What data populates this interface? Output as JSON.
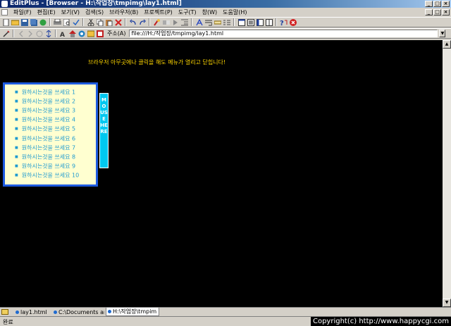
{
  "window": {
    "title": "EditPlus - [Browser - H:\\작업장\\tmpimg\\lay1.html]",
    "minimize_glyph": "_",
    "maximize_glyph": "□",
    "close_glyph": "×"
  },
  "menu": {
    "items": [
      "파일(F)",
      "편집(E)",
      "보기(V)",
      "검색(S)",
      "브라우저(B)",
      "프로젝트(P)",
      "도구(T)",
      "창(W)",
      "도움말(H)"
    ]
  },
  "toolbar1": {
    "icons": [
      "new-file",
      "open",
      "save",
      "save-all",
      "open-remote",
      "print",
      "print-preview",
      "spell-check",
      "cut",
      "copy",
      "paste",
      "delete",
      "undo",
      "redo",
      "find",
      "replace",
      "go-to",
      "indent",
      "word-wrap",
      "html-toolbar",
      "ruler",
      "fullscreen",
      "browser",
      "cliptext",
      "help",
      "close-doc"
    ]
  },
  "toolbar2": {
    "address_label": "주소(A)",
    "address_value": "file:///H:/작업장/tmpimg/lay1.html"
  },
  "page": {
    "message": "브라우저 아무곳에나 클릭을 해도 메뉴가 열리고 닫힙니다!",
    "menu_items": [
      "원하시는것을 쓰세요 1",
      "원하시는것을 쓰세요 2",
      "원하시는것을 쓰세요 3",
      "원하시는것을 쓰세요 4",
      "원하시는것을 쓰세요 5",
      "원하시는것을 쓰세요 6",
      "원하시는것을 쓰세요 7",
      "원하시는것을 쓰세요 8",
      "원하시는것을 쓰세요 9",
      "원하시는것을 쓰세요 10"
    ],
    "tab_label": "MOUSE HERE"
  },
  "doc_tabs": [
    "lay1.html",
    "C:\\Documents an",
    "H:\\작업장\\tmpim"
  ],
  "status": {
    "text": "완료",
    "copyright": "Copyright(c) http://www.happycgi.com"
  },
  "colors": {
    "content_bg": "#000000",
    "message": "#ffd700",
    "menu_bg": "#ffffd0",
    "menu_border": "#1e5be0",
    "menu_text": "#1e9ad0",
    "tab_bg": "#00c8f0"
  }
}
